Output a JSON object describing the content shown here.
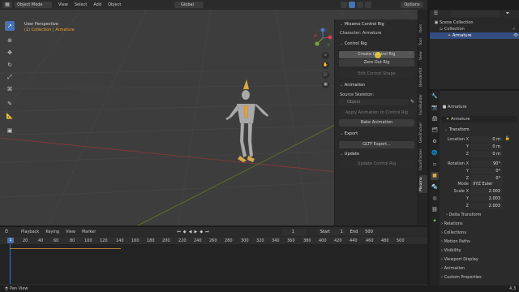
{
  "topbar": {
    "mode": "Object Mode",
    "menus": [
      "View",
      "Select",
      "Add",
      "Object"
    ],
    "transform_orientation": "Global",
    "options_label": "Options"
  },
  "viewport": {
    "perspective_label": "User Perspective",
    "collection_label": "(1) Collection | Armature"
  },
  "npanel": {
    "title": "Mixamo Control Rig",
    "character_label": "Character: Armature",
    "control_rig_section": "Control Rig",
    "create_button": "Create Control Rig",
    "zero_button": "Zero Out Rig",
    "edit_shape_button": "Edit Control Shape",
    "animation_section": "Animation",
    "source_skeleton_label": "Source Skeleton:",
    "source_placeholder": "Object",
    "apply_anim_button": "Apply Animation to Control Rig",
    "bake_button": "Bake Animation",
    "export_section": "Export",
    "gltf_button": "GLTF Export...",
    "update_section": "Update",
    "update_button": "Update Control Rig"
  },
  "npanel_tabs": [
    "Item",
    "Tool",
    "View",
    "BlenderKit",
    "FaceBuilder",
    "GeoTracker",
    "FaceTracker",
    "Mixamo"
  ],
  "outliner": {
    "scene_collection": "Scene Collection",
    "collection": "Collection",
    "armature": "Armature"
  },
  "properties": {
    "object_name": "Armature",
    "data_name": "Armature",
    "transform_section": "Transform",
    "location_label": "Location X",
    "location": [
      "0 m",
      "0 m",
      "0 m"
    ],
    "rotation_label": "Rotation X",
    "rotation": [
      "90°",
      "0°",
      "0°"
    ],
    "mode_label": "Mode",
    "mode_value": "XYZ Euler",
    "scale_label": "Scale X",
    "scale": [
      "2.003",
      "2.003",
      "2.003"
    ],
    "y_label": "Y",
    "z_label": "Z",
    "delta_transform": "Delta Transform",
    "sections": [
      "Relations",
      "Collections",
      "Motion Paths",
      "Visibility",
      "Viewport Display",
      "Animation",
      "Custom Properties"
    ]
  },
  "timeline": {
    "menus": [
      "Playback",
      "Keying",
      "View",
      "Marker"
    ],
    "current_frame": "1",
    "start_label": "Start",
    "start_value": "1",
    "end_label": "End",
    "end_value": "500",
    "ruler": [
      "1",
      "20",
      "40",
      "60",
      "80",
      "100",
      "120",
      "140",
      "160",
      "180",
      "200",
      "220",
      "240",
      "260",
      "280",
      "300",
      "320",
      "340",
      "360",
      "380",
      "400",
      "420",
      "440",
      "460",
      "480",
      "500"
    ]
  },
  "statusbar": {
    "left": "Pan View",
    "version": "4.3"
  },
  "colors": {
    "accent": "#4772b3",
    "keyframe": "#e8a23a"
  }
}
